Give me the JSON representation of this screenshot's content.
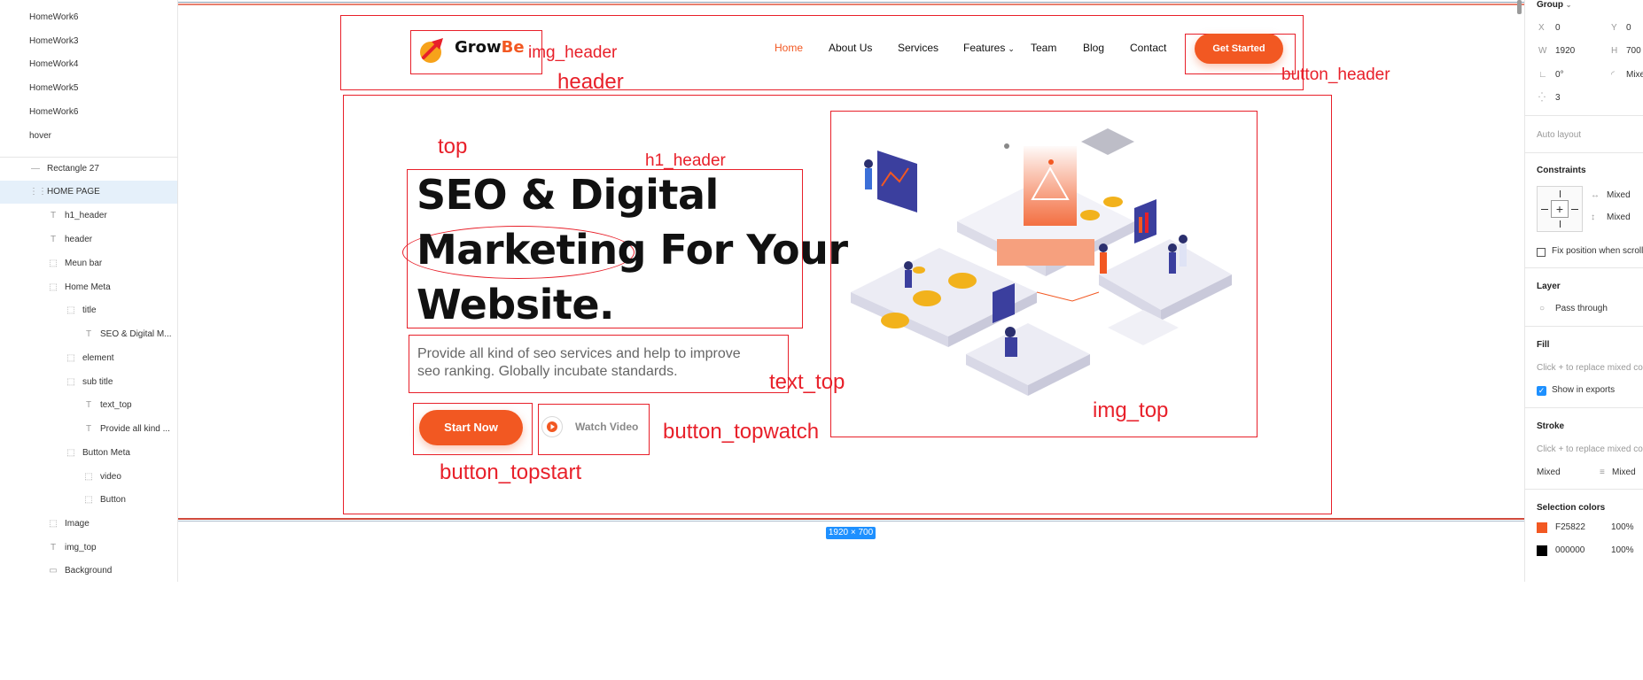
{
  "layers_panel": {
    "items": [
      {
        "label": "HomeWork6"
      },
      {
        "label": "HomeWork3"
      },
      {
        "label": "HomeWork4"
      },
      {
        "label": "HomeWork5"
      },
      {
        "label": "HomeWork6"
      },
      {
        "label": "hover"
      },
      {
        "label": "Rectangle 27"
      },
      {
        "label": "HOME PAGE"
      },
      {
        "label": "h1_header"
      },
      {
        "label": "header"
      },
      {
        "label": "Meun bar"
      },
      {
        "label": "Home Meta"
      },
      {
        "label": "title"
      },
      {
        "label": "SEO & Digital M..."
      },
      {
        "label": "element"
      },
      {
        "label": "sub title"
      },
      {
        "label": "text_top"
      },
      {
        "label": "Provide all kind ..."
      },
      {
        "label": "Button Meta"
      },
      {
        "label": "video"
      },
      {
        "label": "Button"
      },
      {
        "label": "Image"
      },
      {
        "label": "img_top"
      },
      {
        "label": "Background"
      }
    ]
  },
  "site": {
    "logo": {
      "part1": "Grow",
      "part2": "Be"
    },
    "nav": [
      {
        "label": "Home"
      },
      {
        "label": "About Us"
      },
      {
        "label": "Services"
      },
      {
        "label": "Features"
      },
      {
        "label": "Team"
      },
      {
        "label": "Blog"
      },
      {
        "label": "Contact"
      }
    ],
    "get_started": "Get Started",
    "headline": {
      "line1": "SEO & Digital",
      "line2a": "Marketing",
      "line2b": "For Your",
      "line3": "Website."
    },
    "subtitle": {
      "line1": "Provide all kind of seo services and help to improve",
      "line2": "seo ranking. Globally incubate standards."
    },
    "start_now": "Start Now",
    "watch_video": "Watch Video"
  },
  "annotations": {
    "img_header": "img_header",
    "header": "header",
    "button_header": "button_header",
    "top": "top",
    "h1_header": "h1_header",
    "text_top": "text_top",
    "button_topwatch": "button_topwatch",
    "button_topstart": "button_topstart",
    "img_top": "img_top"
  },
  "frame_size": "1920 × 700",
  "props_panel": {
    "group_title": "Group",
    "x_label": "X",
    "x_value": "0",
    "y_label": "Y",
    "y_value": "0",
    "w_label": "W",
    "w_value": "1920",
    "h_label": "H",
    "h_value": "700",
    "rotation": "0°",
    "radius": "Mixed",
    "count": "3",
    "auto_layout": "Auto layout",
    "constraints": "Constraints",
    "constraint_h": "Mixed",
    "constraint_v": "Mixed",
    "fix_position": "Fix position when scrolling",
    "layer": "Layer",
    "blend": "Pass through",
    "fill": "Fill",
    "fill_hint": "Click + to replace mixed content",
    "show_exports": "Show in exports",
    "stroke": "Stroke",
    "stroke_hint": "Click + to replace mixed content",
    "stroke_mixed": "Mixed",
    "stroke_mixed2": "Mixed",
    "selection_colors": "Selection colors",
    "colors": [
      {
        "hex": "F25822",
        "opacity": "100%",
        "swatch": "#f25822"
      },
      {
        "hex": "000000",
        "opacity": "100%",
        "swatch": "#000000"
      }
    ]
  }
}
